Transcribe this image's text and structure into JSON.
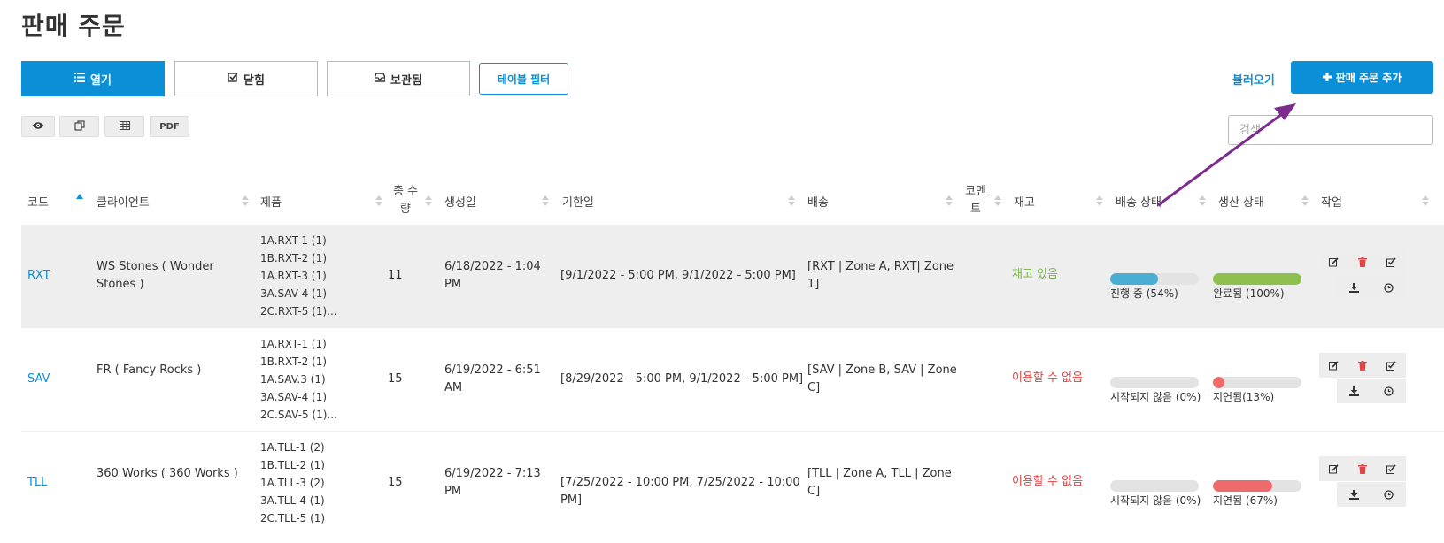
{
  "page": {
    "title": "판매 주문"
  },
  "tabs": [
    {
      "label": "열기",
      "icon": "list-icon",
      "active": true
    },
    {
      "label": "닫힘",
      "icon": "checkbox-icon",
      "active": false
    },
    {
      "label": "보관됨",
      "icon": "inbox-icon",
      "active": false
    }
  ],
  "toolbar": {
    "filter_label": "테이블 필터",
    "load_label": "불러오기",
    "add_label": "판매 주문 추가",
    "pdf_label": "PDF",
    "search_placeholder": "검색"
  },
  "table": {
    "headers": {
      "code": "코드",
      "client": "클라이언트",
      "product": "제품",
      "qty_line1": "총 수",
      "qty_line2": "량",
      "created": "생성일",
      "due": "기한일",
      "shipping": "배송",
      "comment_line1": "코멘",
      "comment_line2": "트",
      "stock": "재고",
      "ship_status": "배송 상태",
      "prod_status": "생산 상태",
      "actions": "작업"
    },
    "rows": [
      {
        "code": "RXT",
        "client_line1": "WS Stones ( Wonder",
        "client_line2": "Stones )",
        "products": [
          "1A.RXT-1 (1)",
          "1B.RXT-2 (1)",
          "1A.RXT-3 (1)",
          "3A.SAV-4 (1)",
          "2C.RXT-5 (1)..."
        ],
        "qty": "11",
        "created_line1": "6/18/2022 - 1:04",
        "created_line2": "PM",
        "due": "[9/1/2022 - 5:00 PM, 9/1/2022 - 5:00 PM]",
        "due_line2": "",
        "shipping_line1": "[RXT | Zone A, RXT| Zone",
        "shipping_line2": "1]",
        "stock": "재고 있음",
        "stock_ok": true,
        "ship_status": {
          "label": "진행 중 (54%)",
          "percent": 54,
          "color": "#4aaed3"
        },
        "prod_status": {
          "label": "완료됨 (100%)",
          "percent": 100,
          "color": "#8dc04f"
        }
      },
      {
        "code": "SAV",
        "client_line1": "FR ( Fancy Rocks )",
        "client_line2": "",
        "products": [
          "1A.RXT-1 (1)",
          "1B.RXT-2 (1)",
          "1A.SAV.3 (1)",
          "3A.SAV-4 (1)",
          "2C.SAV-5 (1)..."
        ],
        "qty": "15",
        "created_line1": "6/19/2022 - 6:51",
        "created_line2": "AM",
        "due": "[8/29/2022 - 5:00 PM, 9/1/2022 - 5:00 PM]",
        "due_line2": "",
        "shipping_line1": "[SAV | Zone B, SAV | Zone",
        "shipping_line2": "C]",
        "stock": "이용할 수 없음",
        "stock_ok": false,
        "ship_status": {
          "label": "시작되지 않음 (0%)",
          "percent": 0,
          "color": "#4aaed3"
        },
        "prod_status": {
          "label": "지연됨(13%)",
          "percent": 13,
          "color": "#ee6b6b"
        }
      },
      {
        "code": "TLL",
        "client_line1": "360 Works ( 360 Works )",
        "client_line2": "",
        "products": [
          "1A.TLL-1 (2)",
          "1B.TLL-2 (1)",
          "1A.TLL-3 (2)",
          "3A.TLL-4 (1)",
          "2C.TLL-5 (1)"
        ],
        "qty": "15",
        "created_line1": "6/19/2022 - 7:13",
        "created_line2": "PM",
        "due": "[7/25/2022 - 10:00 PM, 7/25/2022 - 10:00",
        "due_line2": "PM]",
        "shipping_line1": "[TLL | Zone A, TLL | Zone",
        "shipping_line2": "C]",
        "stock": "이용할 수 없음",
        "stock_ok": false,
        "ship_status": {
          "label": "시작되지 않음 (0%)",
          "percent": 0,
          "color": "#4aaed3"
        },
        "prod_status": {
          "label": "지연됨 (67%)",
          "percent": 67,
          "color": "#ee6b6b"
        }
      }
    ]
  },
  "colors": {
    "accent": "#0b8fd6",
    "arrow": "#7b2c8c",
    "danger": "#e04444",
    "ok": "#7ab648"
  }
}
